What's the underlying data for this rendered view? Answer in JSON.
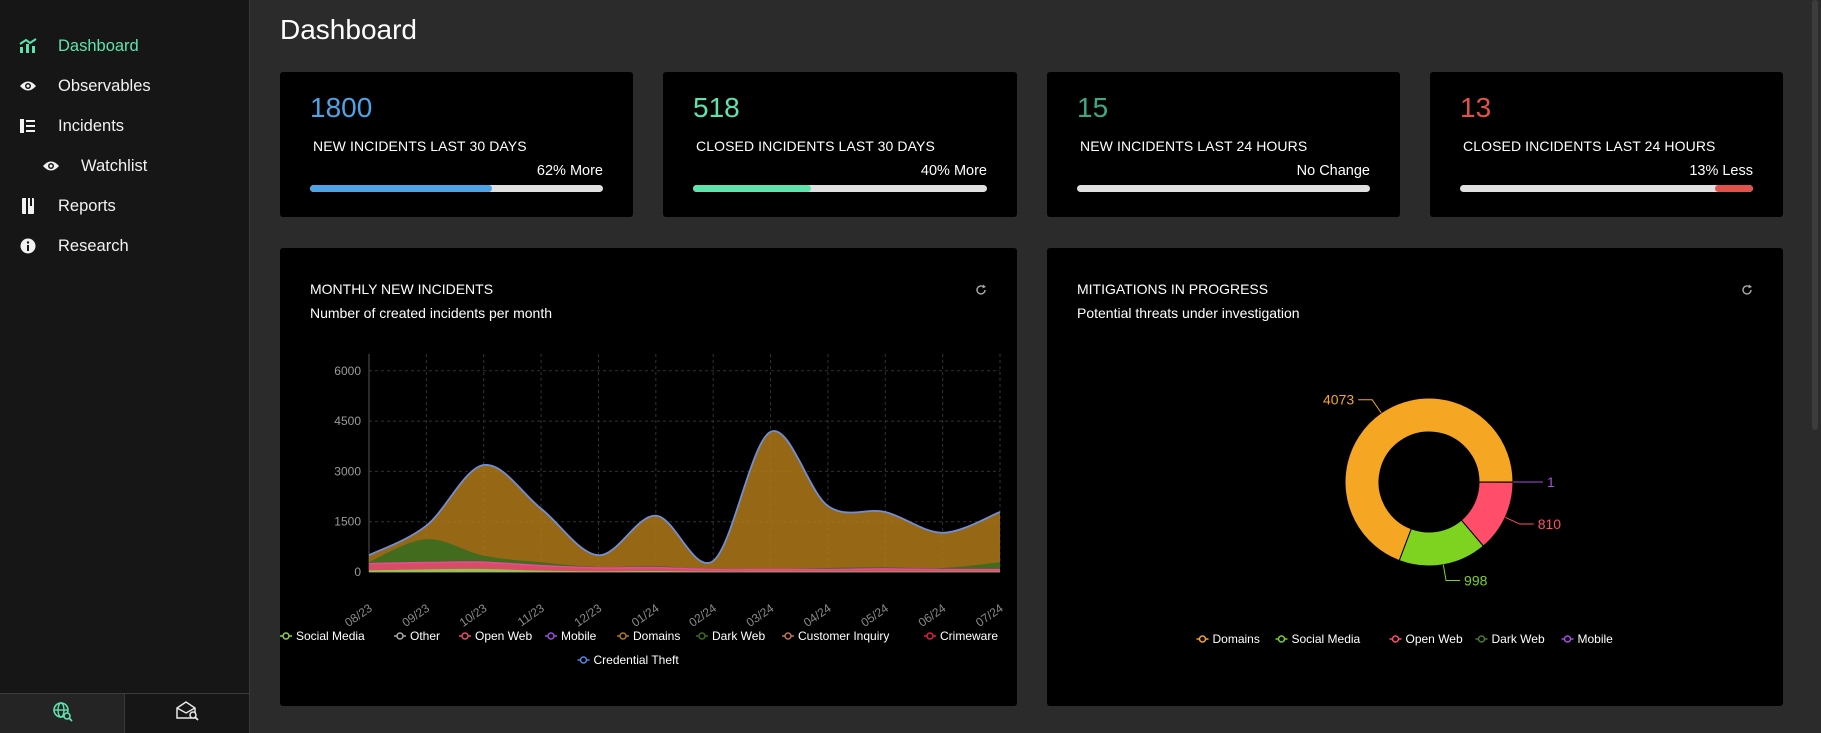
{
  "sidebar": {
    "items": [
      {
        "label": "Dashboard",
        "icon": "chart-icon"
      },
      {
        "label": "Observables",
        "icon": "eye-icon"
      },
      {
        "label": "Incidents",
        "icon": "list-icon"
      },
      {
        "label": "Watchlist",
        "icon": "eye-icon"
      },
      {
        "label": "Reports",
        "icon": "book-icon"
      },
      {
        "label": "Research",
        "icon": "info-icon"
      }
    ],
    "footer": [
      {
        "icon": "globe-search-icon"
      },
      {
        "icon": "mail-search-icon"
      }
    ]
  },
  "page": {
    "title": "Dashboard"
  },
  "stats": [
    {
      "value": "1800",
      "label": "NEW INCIDENTS LAST 30 DAYS",
      "change": "62% More",
      "progress": 0.62,
      "color": "#4da3e6"
    },
    {
      "value": "518",
      "label": "CLOSED INCIDENTS LAST 30 DAYS",
      "change": "40% More",
      "progress": 0.4,
      "color": "#5ee3ad"
    },
    {
      "value": "15",
      "label": "NEW INCIDENTS LAST 24 HOURS",
      "change": "No Change",
      "progress": 0,
      "color": "#3fa882"
    },
    {
      "value": "13",
      "label": "CLOSED INCIDENTS LAST 24 HOURS",
      "change": "13% Less",
      "progress": 0.13,
      "color": "#e0524a"
    }
  ],
  "monthly": {
    "title": "MONTHLY NEW INCIDENTS",
    "subtitle": "Number of created incidents per month"
  },
  "mitigations": {
    "title": "MITIGATIONS IN PROGRESS",
    "subtitle": "Potential threats under investigation"
  },
  "chart_data": [
    {
      "type": "area",
      "categories": [
        "08/23",
        "09/23",
        "10/23",
        "11/23",
        "12/23",
        "01/24",
        "02/24",
        "03/24",
        "04/24",
        "05/24",
        "06/24",
        "07/24"
      ],
      "yticks": [
        0,
        1500,
        3000,
        4500,
        6000
      ],
      "ylim": [
        0,
        6500
      ],
      "grid": true,
      "legend": "bottom",
      "series": [
        {
          "name": "Social Media",
          "color": "#8fd14f",
          "values": [
            50,
            80,
            90,
            40,
            20,
            30,
            10,
            10,
            10,
            10,
            10,
            10
          ]
        },
        {
          "name": "Other",
          "color": "#a8a8a8",
          "values": [
            0,
            0,
            0,
            0,
            0,
            0,
            0,
            0,
            0,
            0,
            0,
            0
          ]
        },
        {
          "name": "Open Web",
          "color": "#e84a6a",
          "values": [
            200,
            200,
            200,
            150,
            100,
            100,
            60,
            60,
            60,
            80,
            60,
            60
          ]
        },
        {
          "name": "Mobile",
          "color": "#9b4de0",
          "values": [
            0,
            0,
            0,
            0,
            0,
            0,
            0,
            0,
            0,
            0,
            0,
            0
          ]
        },
        {
          "name": "Domains",
          "color": "#b07a1a",
          "values": [
            200,
            400,
            2700,
            1600,
            350,
            1500,
            250,
            4100,
            1850,
            1650,
            1050,
            1500
          ]
        },
        {
          "name": "Dark Web",
          "color": "#3a6b1f",
          "values": [
            50,
            700,
            200,
            100,
            30,
            50,
            10,
            10,
            50,
            50,
            50,
            220
          ]
        },
        {
          "name": "Customer Inquiry",
          "color": "#c0745a",
          "values": [
            0,
            0,
            0,
            0,
            0,
            0,
            0,
            0,
            0,
            0,
            0,
            0
          ]
        },
        {
          "name": "Crimeware",
          "color": "#e02040",
          "values": [
            0,
            0,
            0,
            0,
            0,
            0,
            0,
            0,
            0,
            0,
            0,
            0
          ]
        },
        {
          "name": "Credential Theft",
          "color": "#5a84e6",
          "values": [
            0,
            0,
            0,
            0,
            0,
            0,
            0,
            0,
            0,
            0,
            0,
            0
          ]
        }
      ]
    },
    {
      "type": "pie",
      "donut": true,
      "legend": "bottom",
      "slices": [
        {
          "name": "Domains",
          "value": 4073,
          "color": "#f5a623"
        },
        {
          "name": "Social Media",
          "value": 998,
          "color": "#7ed321"
        },
        {
          "name": "Open Web",
          "value": 810,
          "color": "#ff4d6a"
        },
        {
          "name": "Dark Web",
          "value": 0,
          "color": "#4a7a2a"
        },
        {
          "name": "Mobile",
          "value": 1,
          "color": "#a64de0"
        }
      ]
    }
  ]
}
